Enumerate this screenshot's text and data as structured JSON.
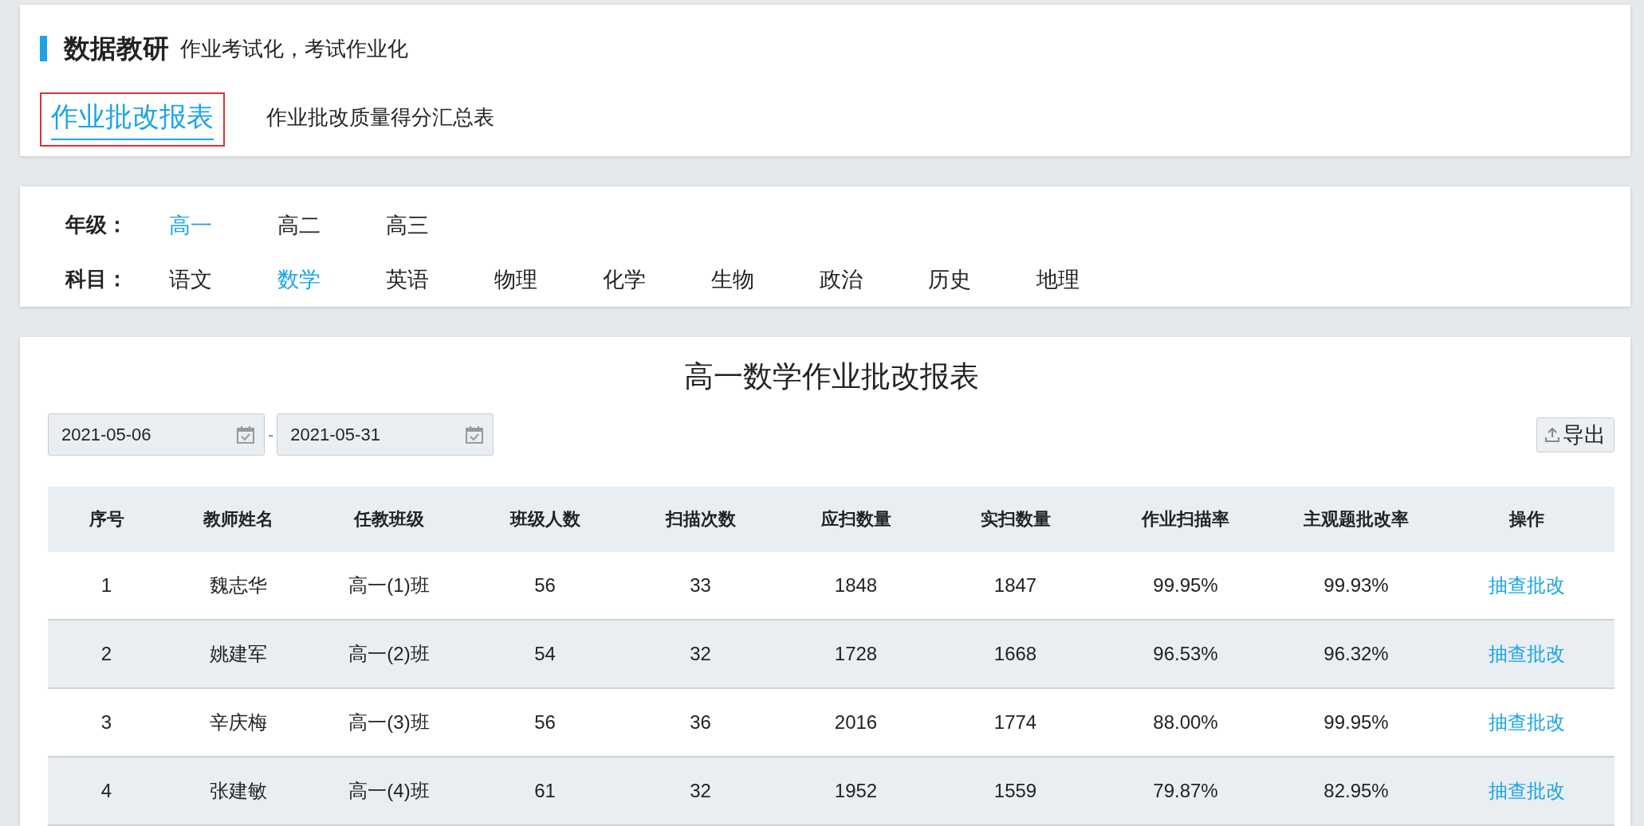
{
  "header": {
    "title": "数据教研",
    "slogan": "作业考试化，考试作业化"
  },
  "tabs": [
    {
      "label": "作业批改报表",
      "selected": true
    },
    {
      "label": "作业批改质量得分汇总表",
      "selected": false
    }
  ],
  "filters": [
    {
      "label": "年级：",
      "options": [
        {
          "label": "高一",
          "selected": true
        },
        {
          "label": "高二",
          "selected": false
        },
        {
          "label": "高三",
          "selected": false
        }
      ]
    },
    {
      "label": "科目：",
      "options": [
        {
          "label": "语文",
          "selected": false
        },
        {
          "label": "数学",
          "selected": true
        },
        {
          "label": "英语",
          "selected": false
        },
        {
          "label": "物理",
          "selected": false
        },
        {
          "label": "化学",
          "selected": false
        },
        {
          "label": "生物",
          "selected": false
        },
        {
          "label": "政治",
          "selected": false
        },
        {
          "label": "历史",
          "selected": false
        },
        {
          "label": "地理",
          "selected": false
        }
      ]
    }
  ],
  "report": {
    "title": "高一数学作业批改报表",
    "date_from": "2021-05-06",
    "date_separator": "-",
    "date_to": "2021-05-31",
    "export_button": "导出",
    "table": {
      "columns": [
        "序号",
        "教师姓名",
        "任教班级",
        "班级人数",
        "扫描次数",
        "应扫数量",
        "实扫数量",
        "作业扫描率",
        "主观题批改率",
        "操作"
      ],
      "rows": [
        {
          "cells": [
            "1",
            "魏志华",
            "高一(1)班",
            "56",
            "33",
            "1848",
            "1847",
            "99.95%",
            "99.93%"
          ],
          "action": "抽查批改"
        },
        {
          "cells": [
            "2",
            "姚建军",
            "高一(2)班",
            "54",
            "32",
            "1728",
            "1668",
            "96.53%",
            "96.32%"
          ],
          "action": "抽查批改"
        },
        {
          "cells": [
            "3",
            "辛庆梅",
            "高一(3)班",
            "56",
            "36",
            "2016",
            "1774",
            "88.00%",
            "99.95%"
          ],
          "action": "抽查批改"
        },
        {
          "cells": [
            "4",
            "张建敏",
            "高一(4)班",
            "61",
            "32",
            "1952",
            "1559",
            "79.87%",
            "82.95%"
          ],
          "action": "抽查批改"
        }
      ]
    }
  }
}
